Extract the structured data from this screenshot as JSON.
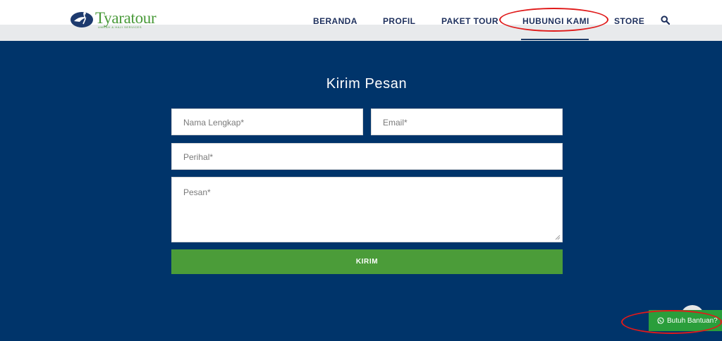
{
  "brand": {
    "name": "Tyaratour",
    "tagline": "UMRAH & HAJI SERVICES",
    "color": "#4a9a3a"
  },
  "nav": {
    "items": [
      {
        "label": "BERANDA"
      },
      {
        "label": "PROFIL"
      },
      {
        "label": "PAKET TOUR"
      },
      {
        "label": "HUBUNGI KAMI",
        "active": true
      },
      {
        "label": "STORE"
      }
    ],
    "search_icon": "search-icon"
  },
  "contact_form": {
    "title": "Kirim Pesan",
    "name_placeholder": "Nama Lengkap*",
    "email_placeholder": "Email*",
    "subject_placeholder": "Perihal*",
    "message_placeholder": "Pesan*",
    "submit_label": "KIRIM"
  },
  "help_button": {
    "label": "Butuh Bantuan?",
    "icon": "whatsapp-icon"
  },
  "colors": {
    "navy": "#00346a",
    "green_button": "#4b9c39",
    "whatsapp_green": "#2a9e3b",
    "nav_text": "#1d2f5c",
    "annotation_red": "#e01a1a"
  }
}
